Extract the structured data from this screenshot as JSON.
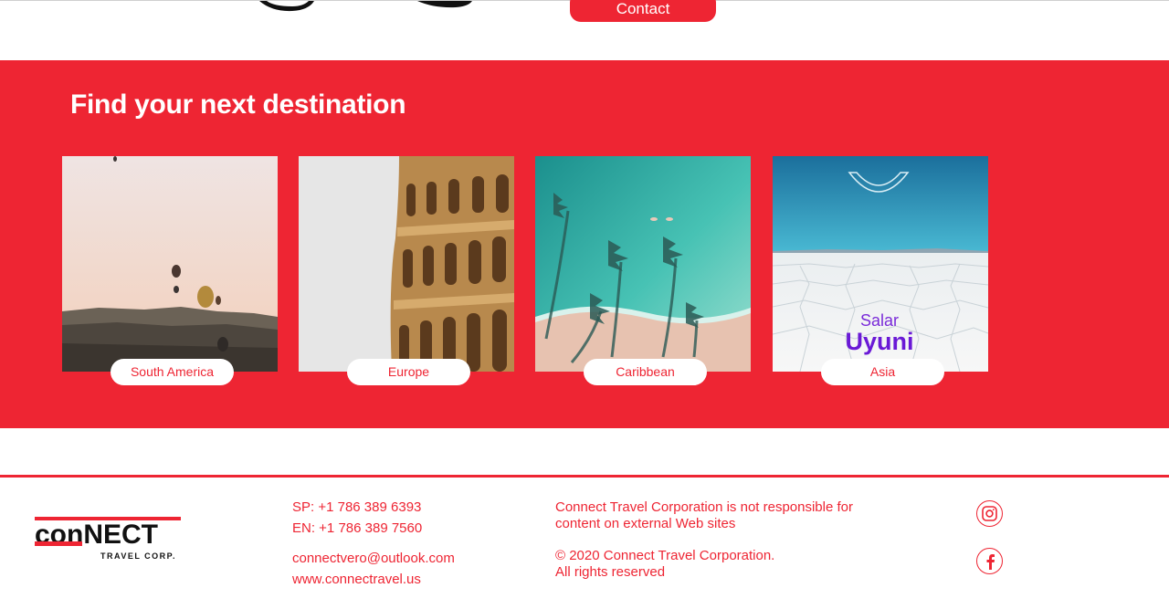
{
  "header": {
    "contact_label": "Contact"
  },
  "destinations": {
    "title": "Find your next destination",
    "items": [
      {
        "label": "South America"
      },
      {
        "label": "Europe"
      },
      {
        "label": "Caribbean"
      },
      {
        "label": "Asia",
        "image_text_top": "Salar",
        "image_text_main": "Uyuni"
      }
    ]
  },
  "footer": {
    "logo_main": "conNECT",
    "logo_sub": "TRAVEL CORP.",
    "phone_sp": "SP: +1 786 389 6393",
    "phone_en": "EN: +1 786 389 7560",
    "email": "connectvero@outlook.com",
    "website": "www.connectravel.us",
    "disclaimer_1": "Connect Travel Corporation is not responsible for",
    "disclaimer_2": "content on external Web sites",
    "copyright_1": "© 2020 Connect Travel Corporation.",
    "copyright_2": "All rights reserved",
    "social": [
      "instagram-icon",
      "facebook-icon"
    ]
  },
  "colors": {
    "brand_red": "#ee2533",
    "white": "#ffffff",
    "dark": "#1a1a1a"
  }
}
